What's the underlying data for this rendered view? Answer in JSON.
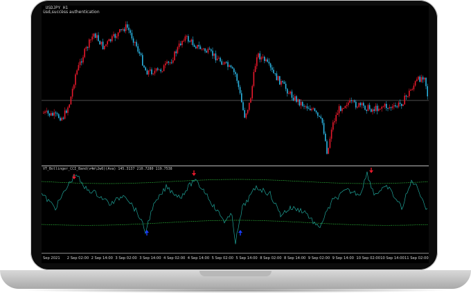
{
  "chart": {
    "title": "_USDJPY_H1",
    "subtitle": "usd,success authentication",
    "indicator_label": "VT_Bollinger_CCI_Band(v4m\\2w6)(Ava) 145.3137 210.7280 119.7538",
    "colors": {
      "bull": "#e8192c",
      "bear": "#2bb5e3",
      "line": "#1fa59a",
      "band": "#2fbf3d",
      "sell_arrow": "#e8192c",
      "buy_arrow": "#1a3cff",
      "grid_line": "#a0a0a0"
    },
    "time_ticks": [
      "Sep 2021",
      "2 Sep 02:00",
      "2 Sep 14:00",
      "3 Sep 02:00",
      "3 Sep 14:00",
      "4 Sep 02:00",
      "4 Sep 14:00",
      "5 Sep 02:00",
      "5 Sep 14:00",
      "8 Sep 02:00",
      "8 Sep 14:00",
      "9 Sep 02:00",
      "9 Sep 14:00",
      "10 Sep 02:00",
      "10 Sep 14:00",
      "11 Sep 02:00",
      "11"
    ],
    "signals": {
      "sell_arrows": 3,
      "buy_arrows": 2
    }
  }
}
